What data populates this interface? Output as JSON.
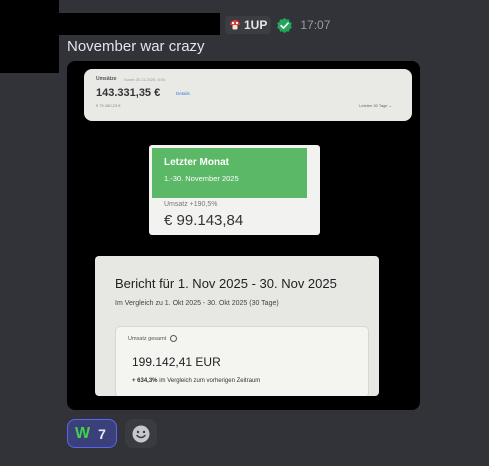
{
  "message": {
    "tag": "1UP",
    "timestamp": "17:07",
    "text": "November war crazy",
    "colors": {
      "verified": "#23a55a",
      "tag_icon": "#e23b3b"
    }
  },
  "attachment": {
    "card1": {
      "label": "Umsätze",
      "sub": "Sonnt 30.11.2025, 8:00",
      "amount": "143.331,35 €",
      "link": "Details",
      "prev": "€ 79.280,23 €",
      "period": "Letzten 30 Tage ⌄"
    },
    "card2": {
      "title": "Letzter Monat",
      "range": "1.-30. November 2025",
      "umsatz": "Umsatz +190,5%",
      "amount": "€ 99.143,84"
    },
    "card3": {
      "title": "Bericht für 1. Nov 2025 - 30. Nov 2025",
      "compare": "Im Vergleich zu 1. Okt 2025 - 30. Okt 2025 (30 Tage)",
      "umsatz_label": "Umsatz gesamt",
      "amount": "199.142,41 EUR",
      "growth_value": "+ 634,3%",
      "growth_text": "im Vergleich zum vorherigen Zeitraum"
    }
  },
  "reactions": {
    "w": {
      "emoji": "W",
      "count": "7"
    },
    "add_icon": "smiley-icon"
  }
}
